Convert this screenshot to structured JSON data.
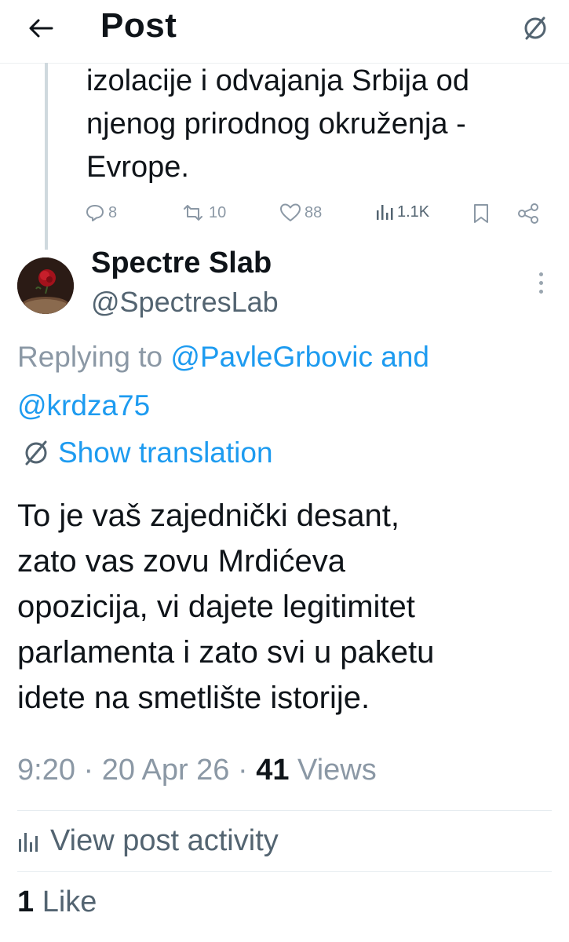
{
  "header": {
    "title": "Post"
  },
  "previous_tweet": {
    "lines": [
      "izolacije i odvajanja Srbija od",
      "njenog prirodnog okruženja -",
      "Evrope."
    ],
    "actions": {
      "replies": "8",
      "reposts": "10",
      "likes": "88",
      "views": "1.1K"
    }
  },
  "tweet": {
    "author_name": "Spectre Slab",
    "author_handle": "@SpectresLab",
    "replying_prefix": "Replying to ",
    "replying_user1": "@PavleGrbovic",
    "replying_and": " and",
    "replying_user2": "@krdza75",
    "show_translation": "Show translation",
    "text_lines": [
      "To je vaš zajednički desant,",
      "zato vas zovu Mrdićeva",
      "opozicija, vi dajete legitimitet",
      "parlamenta i zato svi u paketu",
      "idete na smetlište istorije."
    ],
    "time": "9:20",
    "date": "20 Apr 26",
    "sep": " · ",
    "views_count": "41",
    "views_label": " Views",
    "activity_label": "View post activity",
    "likes_count": "1",
    "likes_label": " Like"
  },
  "icons": {
    "back": "arrow-left-icon",
    "translate": "translate-icon",
    "reply": "reply-icon",
    "repost": "repost-icon",
    "like": "heart-icon",
    "views": "bar-chart-icon",
    "bookmark": "bookmark-icon",
    "share": "share-icon",
    "more": "more-vertical-icon"
  },
  "colors": {
    "link": "#1d9bf0",
    "muted": "#8b98a5",
    "text": "#0f1419"
  }
}
